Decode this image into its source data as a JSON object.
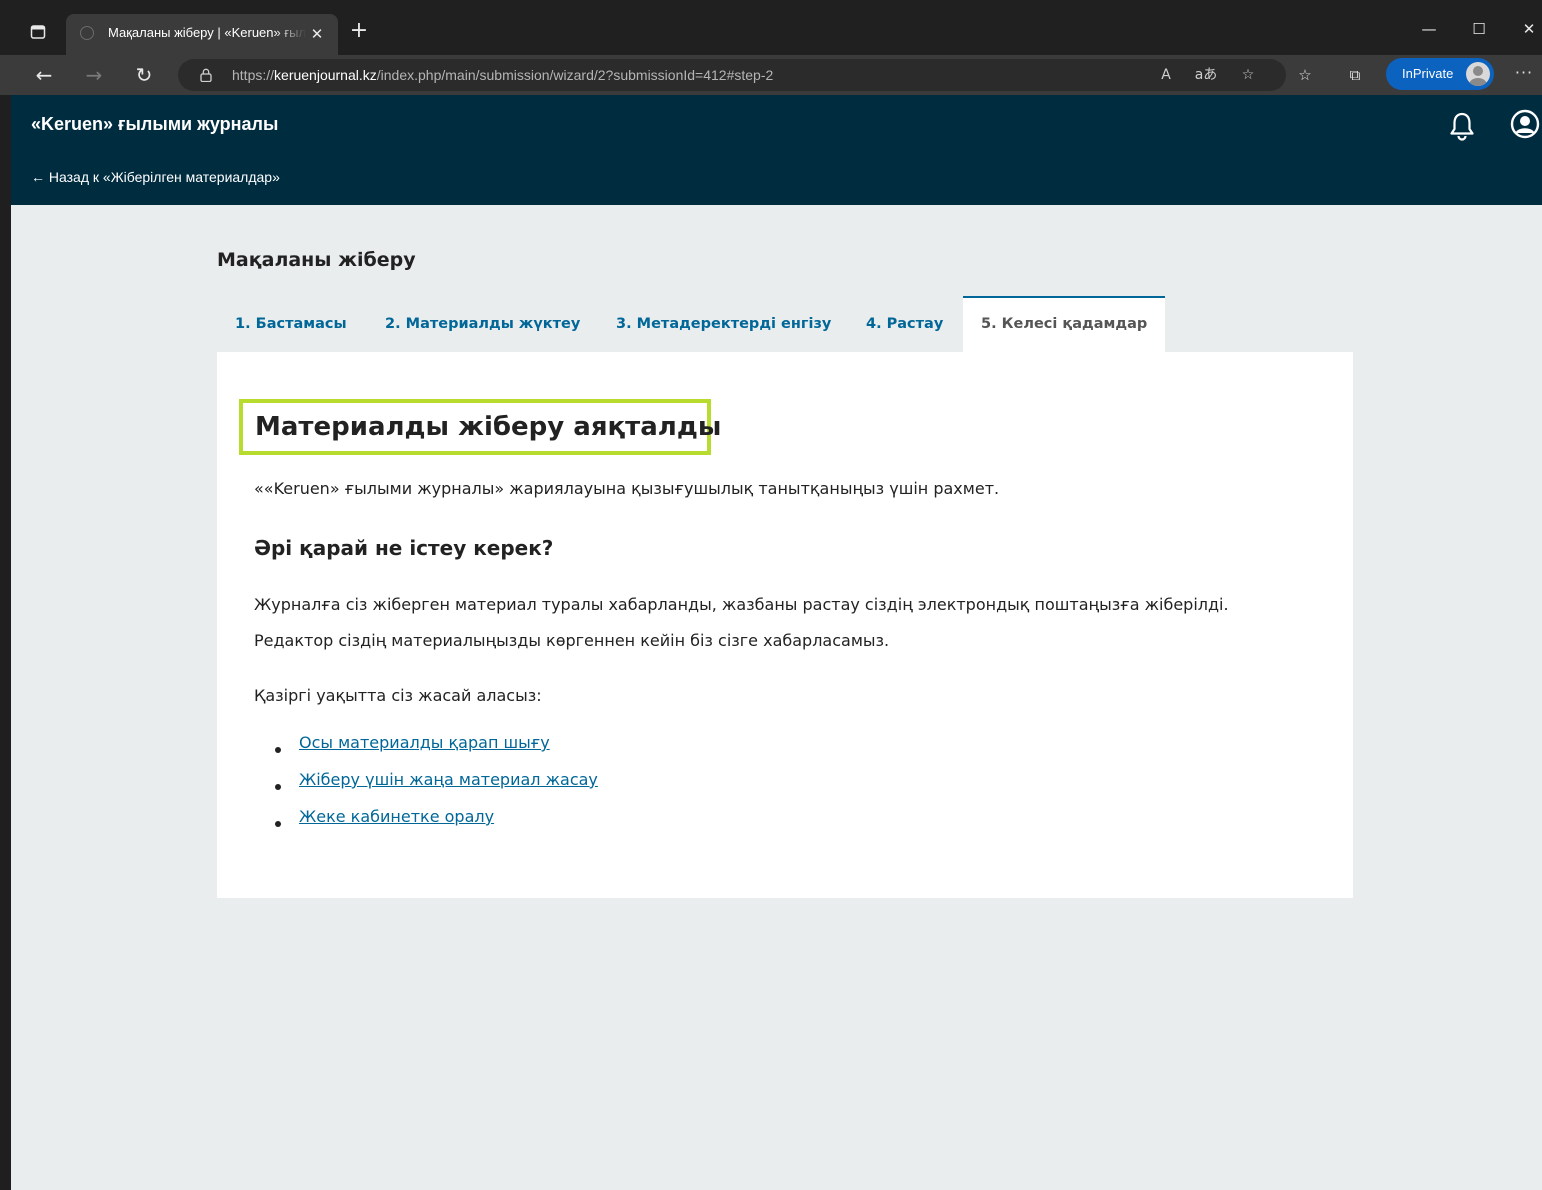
{
  "browser": {
    "tab_title": "Мақаланы жіберу | «Keruen» ғылыми журналы",
    "url_prefix": "https://",
    "url_domain": "keruenjournal.kz",
    "url_path": "/index.php/main/submission/wizard/2?submissionId=412#step-2",
    "inprivate_label": "InPrivate",
    "read_aloud_label": "A",
    "translate_label": "aあ"
  },
  "site": {
    "journal_title": "«Keruen» ғылыми журналы",
    "back_link": "← Назад к «Жіберілген материалдар»"
  },
  "page": {
    "title": "Мақаланы жіберу",
    "steps": [
      {
        "label": "1. Бастамасы"
      },
      {
        "label": "2. Материалды жүктеу"
      },
      {
        "label": "3. Метадеректерді енгізу"
      },
      {
        "label": "4. Растау"
      },
      {
        "label": "5. Келесі қадамдар"
      }
    ],
    "completed_heading": "Материалды жіберу аяқталды",
    "thanks_text": "««Keruen» ғылыми журналы» жариялауына қызығушылық танытқаныңыз үшін рахмет.",
    "next_heading": "Әрі қарай не істеу керек?",
    "para_line1": "Журналға сіз жіберген материал туралы хабарланды, жазбаны растау сіздің электрондық поштаңызға жіберілді.",
    "para_line2": "Редактор сіздің материалыңызды көргеннен кейін біз сізге хабарласамыз.",
    "options_intro": "Қазіргі уақытта сіз жасай аласыз:",
    "links": [
      {
        "label": "Осы материалды қарап шығу"
      },
      {
        "label": "Жіберу үшін жаңа материал жасау"
      },
      {
        "label": "Жеке кабинетке оралу"
      }
    ]
  }
}
